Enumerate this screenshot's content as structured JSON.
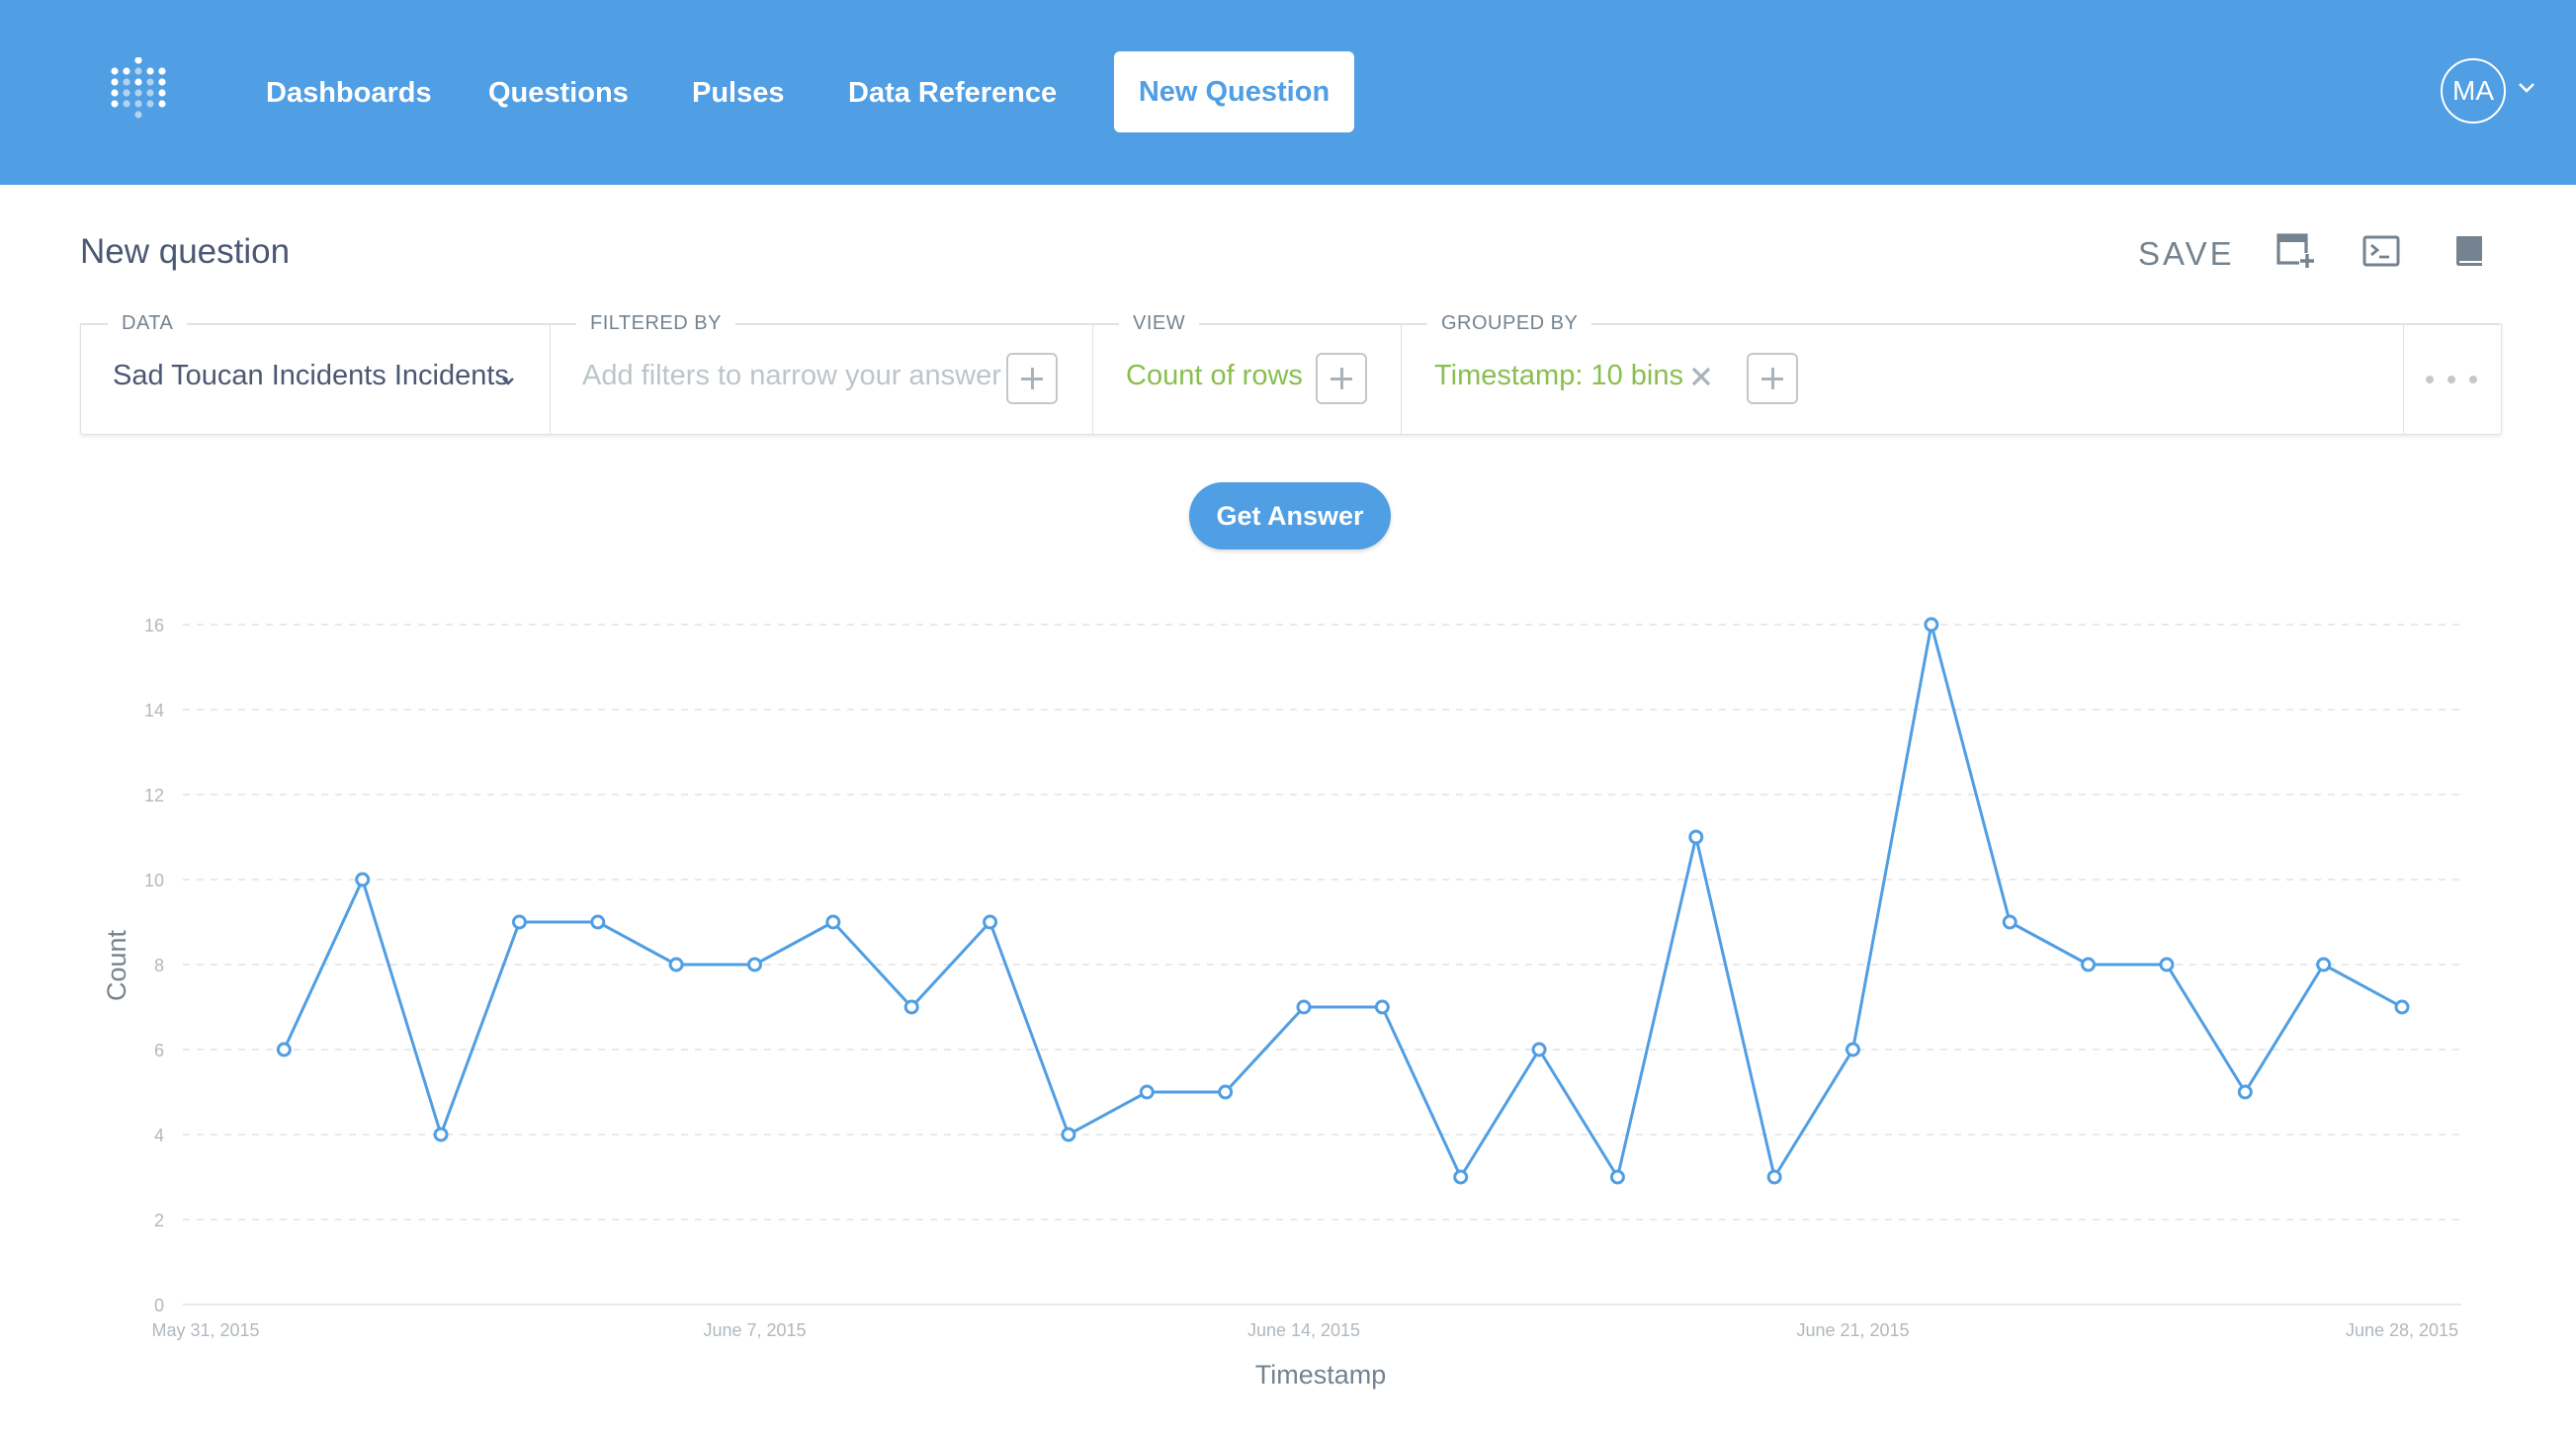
{
  "nav": {
    "items": [
      "Dashboards",
      "Questions",
      "Pulses",
      "Data Reference"
    ],
    "new_question": "New Question",
    "avatar_initials": "MA"
  },
  "header": {
    "title": "New question",
    "save_label": "SAVE",
    "icons": [
      "add-to-dashboard-icon",
      "sql-editor-icon",
      "data-reference-icon"
    ]
  },
  "query_builder": {
    "data_label": "DATA",
    "data_value": "Sad Toucan Incidents Incidents",
    "filter_label": "FILTERED BY",
    "filter_placeholder": "Add filters to narrow your answer",
    "view_label": "VIEW",
    "view_value": "Count of rows",
    "group_label": "GROUPED BY",
    "group_value": "Timestamp: 10 bins"
  },
  "get_answer_label": "Get Answer",
  "colors": {
    "brand": "#509ee3",
    "accent_green": "#88bf4d",
    "line": "#509ee3"
  },
  "chart_data": {
    "type": "line",
    "xlabel": "Timestamp",
    "ylabel": "Count",
    "ylim": [
      0,
      16
    ],
    "yticks": [
      0,
      2,
      4,
      6,
      8,
      10,
      12,
      14,
      16
    ],
    "x_tick_labels": [
      "May 31, 2015",
      "June 7, 2015",
      "June 14, 2015",
      "June 21, 2015",
      "June 28, 2015"
    ],
    "x_tick_dates": [
      "2015-05-31",
      "2015-06-07",
      "2015-06-14",
      "2015-06-21",
      "2015-06-28"
    ],
    "grid": "horizontal dashed",
    "series": [
      {
        "x": [
          "2015-06-01",
          "2015-06-02",
          "2015-06-03",
          "2015-06-04",
          "2015-06-05",
          "2015-06-06",
          "2015-06-07",
          "2015-06-08",
          "2015-06-09",
          "2015-06-10",
          "2015-06-11",
          "2015-06-12",
          "2015-06-13",
          "2015-06-14",
          "2015-06-15",
          "2015-06-16",
          "2015-06-17",
          "2015-06-18",
          "2015-06-19",
          "2015-06-20",
          "2015-06-21",
          "2015-06-22",
          "2015-06-23",
          "2015-06-24",
          "2015-06-25",
          "2015-06-26",
          "2015-06-27",
          "2015-06-28"
        ],
        "values": [
          6,
          10,
          4,
          9,
          9,
          8,
          8,
          9,
          7,
          9,
          4,
          5,
          5,
          7,
          7,
          3,
          6,
          3,
          11,
          3,
          6,
          16,
          9,
          8,
          8,
          5,
          8,
          7
        ]
      }
    ]
  }
}
